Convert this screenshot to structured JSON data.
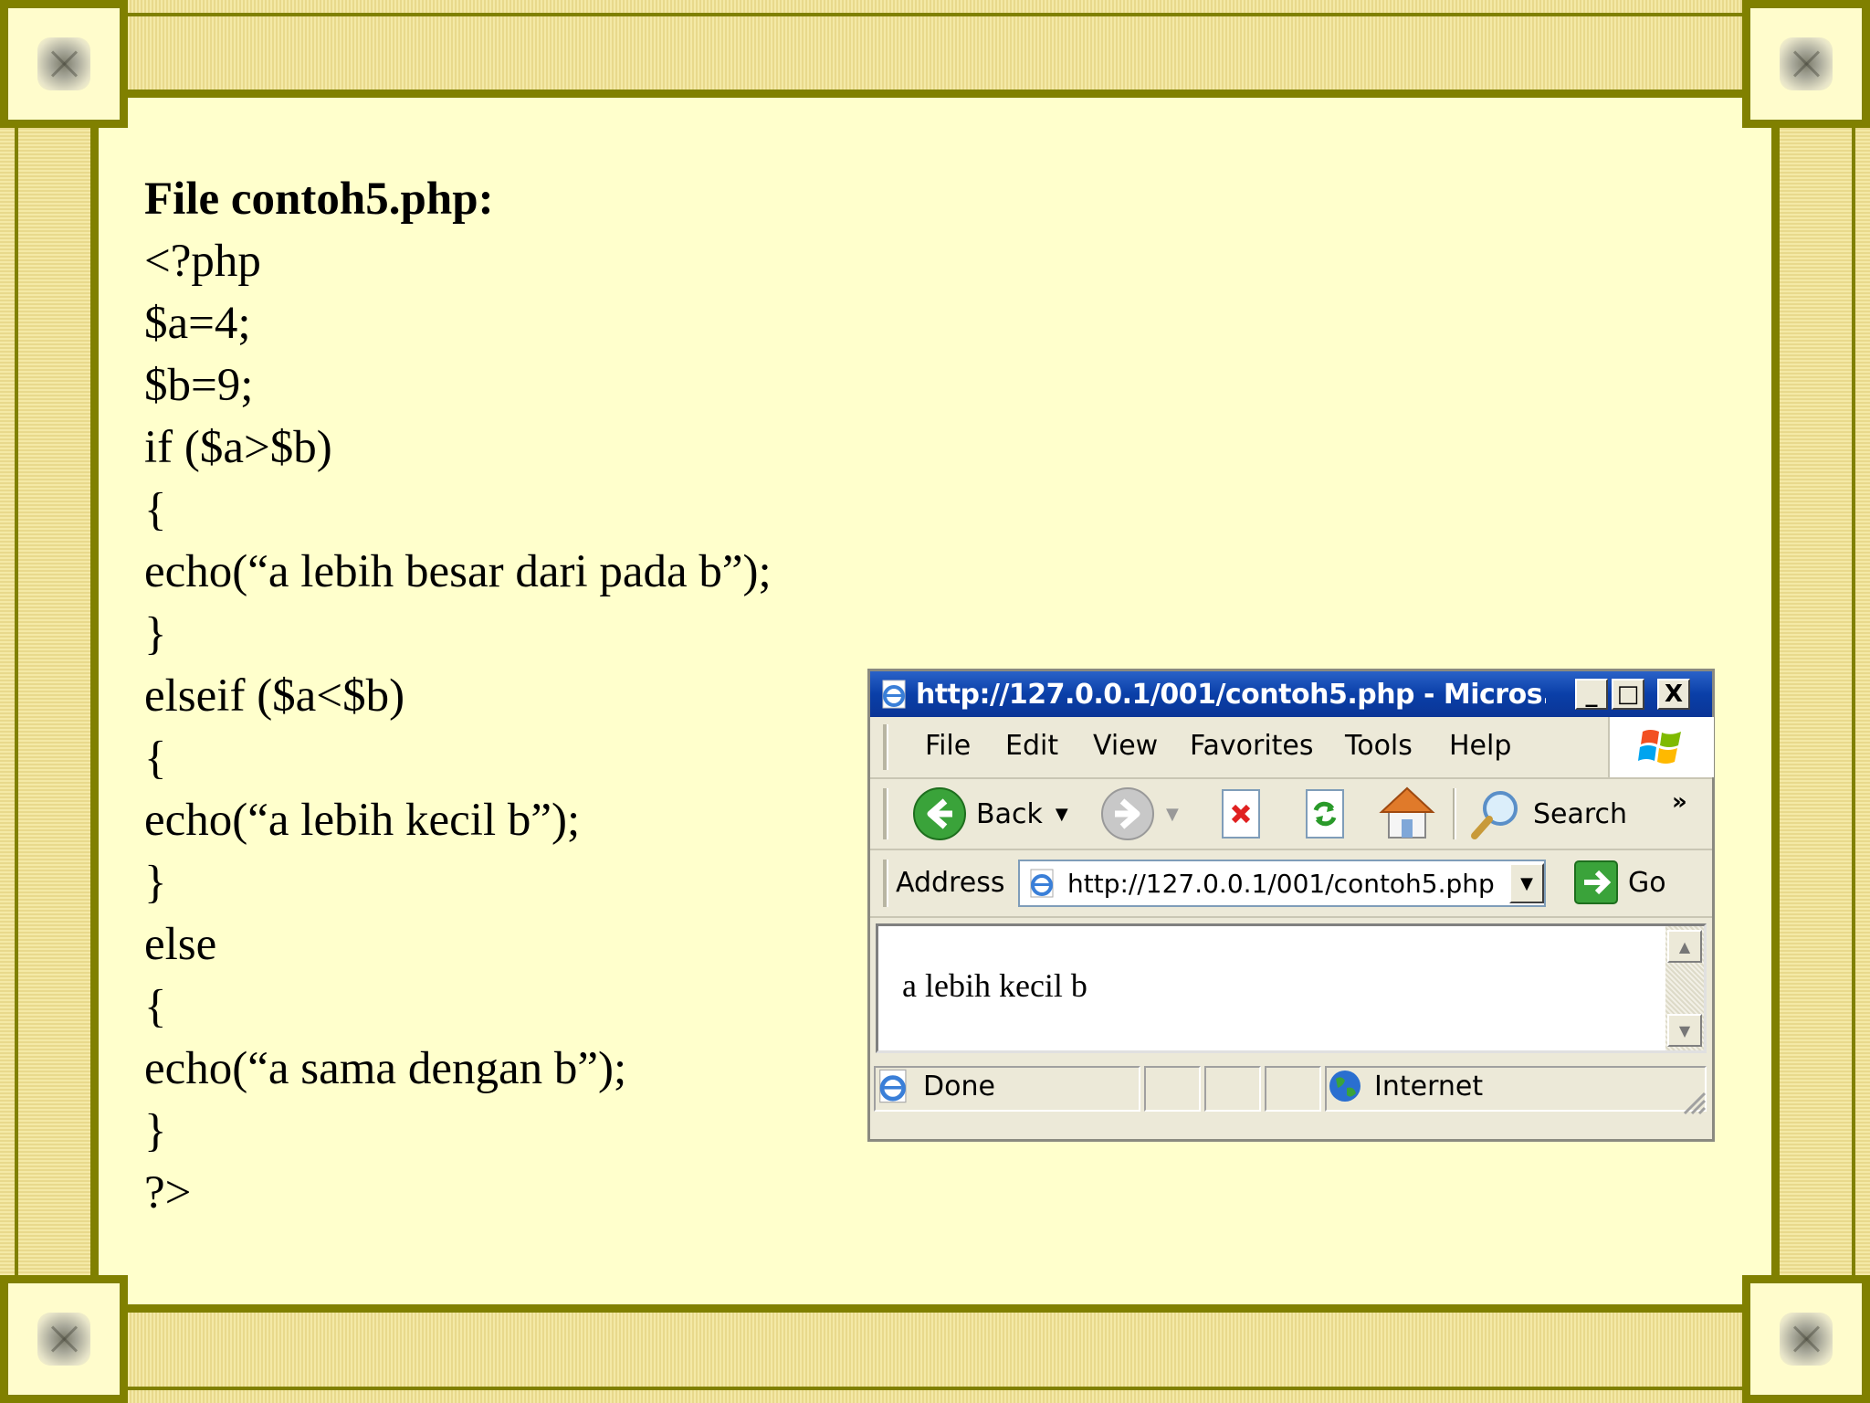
{
  "slide": {
    "heading": "File contoh5.php:",
    "code_lines": [
      "<?php",
      "$a=4;",
      "$b=9;",
      "if ($a>$b)",
      "{",
      "echo(“a lebih besar dari pada b”);",
      "}",
      "elseif ($a<$b)",
      "{",
      "echo(“a lebih kecil b”);",
      "}",
      "else",
      "{",
      "echo(“a sama dengan b”);",
      "}",
      "?>"
    ]
  },
  "browser": {
    "title": "http://127.0.0.1/001/contoh5.php - Micros...",
    "window_buttons": {
      "minimize": "_",
      "maximize": "□",
      "close": "X"
    },
    "menu": [
      "File",
      "Edit",
      "View",
      "Favorites",
      "Tools",
      "Help"
    ],
    "toolbar": {
      "back": "Back",
      "search": "Search",
      "more": "»"
    },
    "address": {
      "label": "Address",
      "url": "http://127.0.0.1/001/contoh5.php",
      "go": "Go"
    },
    "page_output": "a lebih kecil b",
    "status": {
      "left": "Done",
      "zone": "Internet"
    }
  },
  "colors": {
    "slide_background": "#ffffcc",
    "frame_olive": "#808000",
    "titlebar_blue": "#0a3fa8"
  },
  "icons": [
    "ie-page-icon",
    "windows-logo-icon",
    "back-arrow-icon",
    "forward-arrow-icon",
    "stop-icon",
    "refresh-icon",
    "home-icon",
    "search-magnifier-icon",
    "go-arrow-icon",
    "globe-icon",
    "frame-corner-knob-icon"
  ]
}
